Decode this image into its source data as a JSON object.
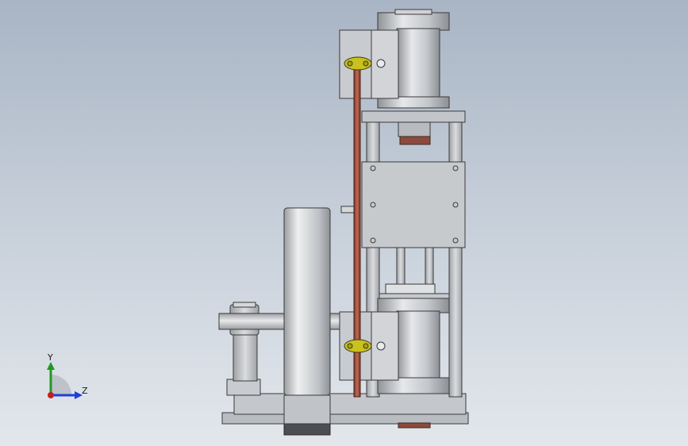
{
  "viewport": {
    "background_top": "#a9b5c5",
    "background_bottom": "#e3e7ec"
  },
  "triad": {
    "y_label": "Y",
    "z_label": "Z",
    "y_color": "#1f9a1f",
    "z_color": "#1f3fd8",
    "x_color": "#c81e1e"
  },
  "model": {
    "metal_color": "#c9ccd0",
    "rod_color": "#9b4a3a",
    "bracket_color": "#c7c21c"
  }
}
